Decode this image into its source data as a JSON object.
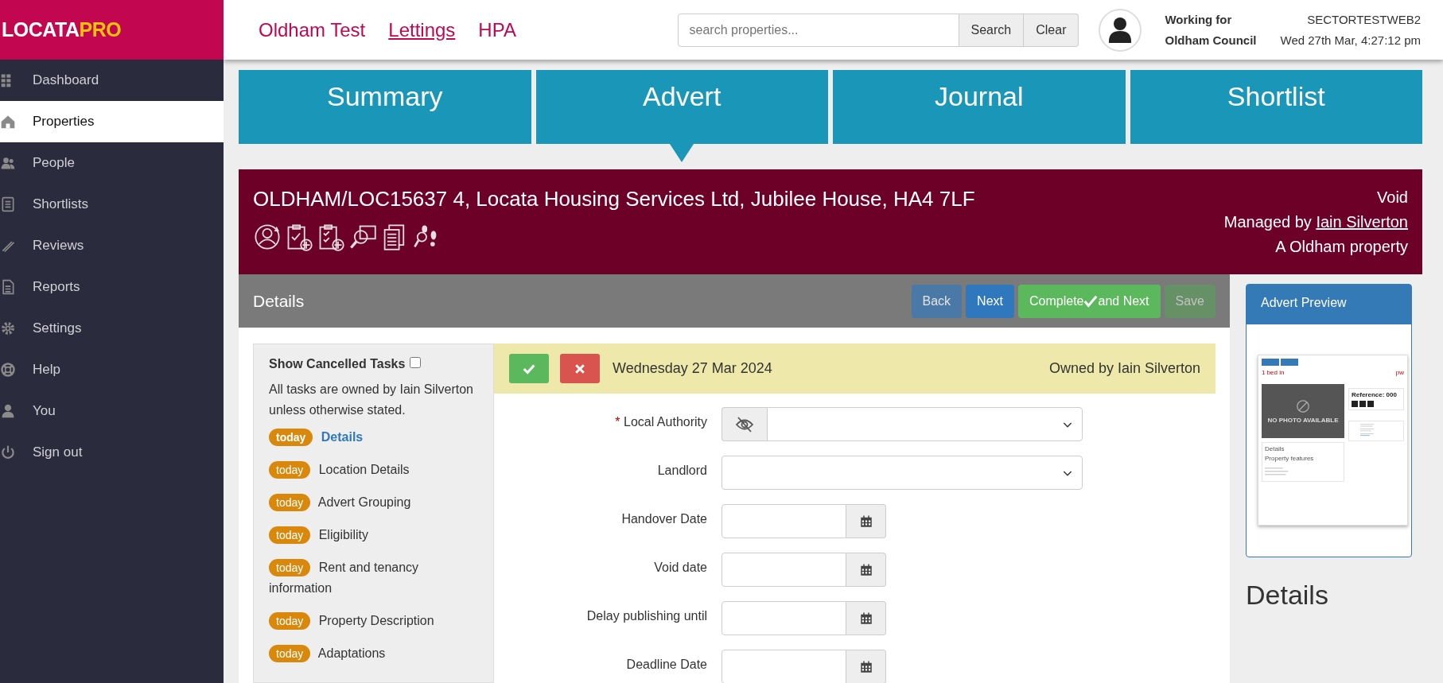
{
  "logo": {
    "main": "LOCATA",
    "accent": "PRO"
  },
  "sidebar": {
    "items": [
      {
        "label": "Dashboard",
        "selected": false
      },
      {
        "label": "Properties",
        "selected": true
      },
      {
        "label": "People",
        "selected": false
      },
      {
        "label": "Shortlists",
        "selected": false
      },
      {
        "label": "Reviews",
        "selected": false
      },
      {
        "label": "Reports",
        "selected": false
      },
      {
        "label": "Settings",
        "selected": false
      },
      {
        "label": "Help",
        "selected": false
      },
      {
        "label": "You",
        "selected": false
      },
      {
        "label": "Sign out",
        "selected": false
      }
    ]
  },
  "header": {
    "nav": [
      {
        "label": "Oldham Test",
        "underlined": false
      },
      {
        "label": "Lettings",
        "underlined": true
      },
      {
        "label": "HPA",
        "underlined": false
      }
    ],
    "search": {
      "placeholder": "search properties..."
    },
    "search_buttons": [
      "Search",
      "Clear"
    ],
    "working_for": "Working for",
    "organisation": "Oldham Council",
    "server": "SECTORTESTWEB2",
    "datetime": "Wed 27th Mar, 4:27:12 pm"
  },
  "tabs": [
    {
      "label": "Summary",
      "selected": false
    },
    {
      "label": "Advert",
      "selected": true
    },
    {
      "label": "Journal",
      "selected": false
    },
    {
      "label": "Shortlist",
      "selected": false
    }
  ],
  "banner": {
    "title": "OLDHAM/LOC15637 4, Locata Housing Services Ltd, Jubilee House, HA4 7LF",
    "status": "Void",
    "managed_prefix": "Managed by",
    "manager": "Iain Silverton",
    "ownership": "A Oldham property"
  },
  "section": {
    "title": "Details",
    "buttons": [
      {
        "label": "Back",
        "kind": "back",
        "disabled": false
      },
      {
        "label": "Next",
        "kind": "primary",
        "disabled": false
      },
      {
        "label": "Complete",
        "label_after": "and Next",
        "kind": "complete",
        "disabled": false
      },
      {
        "label": "Save",
        "kind": "save",
        "disabled": true
      }
    ]
  },
  "tasks": {
    "show_cancelled": {
      "label": "Show Cancelled Tasks",
      "checked": false
    },
    "note": "All tasks are owned by Iain Silverton unless otherwise stated.",
    "items": [
      {
        "badge": "today",
        "label": "Details",
        "selected": true
      },
      {
        "badge": "today",
        "label": "Location Details",
        "selected": false
      },
      {
        "badge": "today",
        "label": "Advert Grouping",
        "selected": false
      },
      {
        "badge": "today",
        "label": "Eligibility",
        "selected": false
      },
      {
        "badge": "today",
        "label": "Rent and tenancy information",
        "selected": false
      },
      {
        "badge": "today",
        "label": "Property Description",
        "selected": false
      },
      {
        "badge": "today",
        "label": "Adaptations",
        "selected": false
      }
    ]
  },
  "task_header": {
    "date": "Wednesday 27 Mar 2024",
    "owner": "Owned by Iain Silverton"
  },
  "form": {
    "fields": [
      {
        "label": "Local Authority",
        "required_mark": "*",
        "kind": "hidden-select"
      },
      {
        "label": "Landlord",
        "kind": "select"
      },
      {
        "label": "Handover Date",
        "kind": "date"
      },
      {
        "label": "Void date",
        "kind": "date"
      },
      {
        "label": "Delay publishing until",
        "kind": "date"
      },
      {
        "label": "Deadline Date",
        "kind": "date"
      }
    ]
  },
  "preview": {
    "title": "Advert Preview",
    "thumbnail": {
      "heading": "1 bed in",
      "rent": "pw",
      "photo_note": "NO PHOTO AVAILABLE",
      "reference": "Reference: 000",
      "tab": "Details",
      "features": "Property features"
    }
  },
  "aside_heading": "Details"
}
